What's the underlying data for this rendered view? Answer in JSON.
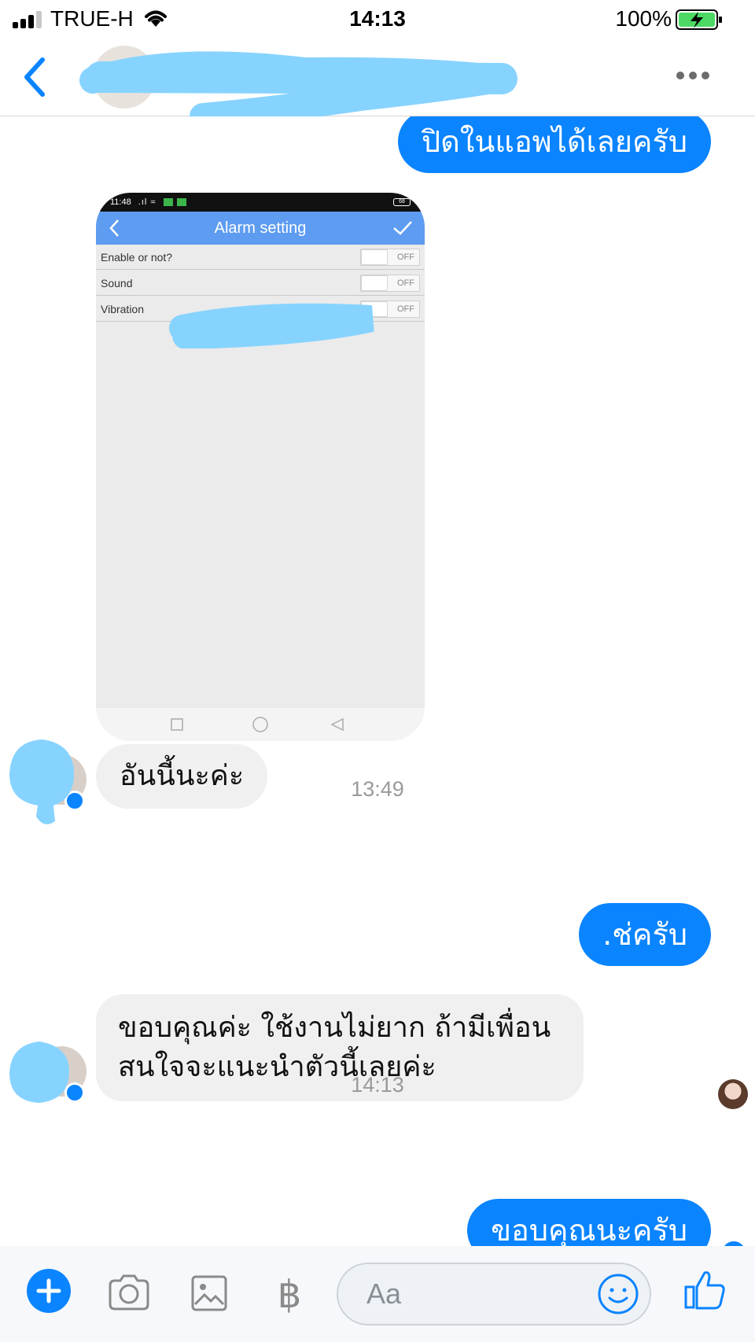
{
  "status_bar": {
    "carrier": "TRUE-H",
    "time": "14:13",
    "battery": "100%"
  },
  "header": {
    "contact_name": "",
    "colors": {
      "accent": "#0a84ff"
    }
  },
  "shared_image": {
    "status_time": "11:48",
    "battery_label": "68",
    "title": "Alarm setting",
    "rows": [
      {
        "label": "Enable or not?",
        "state": "OFF"
      },
      {
        "label": "Sound",
        "state": "OFF"
      },
      {
        "label": "Vibration",
        "state": "OFF"
      }
    ]
  },
  "messages": {
    "out_1": "ปิดในแอพได้เลยครับ",
    "in_1": "อันนี้นะค่ะ",
    "time_1": "13:49",
    "out_2": ".ช่ครับ",
    "in_2_line1": "ขอบคุณค่ะ ใช้งานไม่ยาก ถ้ามีเพื่อน",
    "in_2_line2": "สนใจจะแนะนำตัวนี้เลยค่ะ",
    "time_2": "14:13",
    "out_3": "ขอบคุณนะครับ"
  },
  "composer": {
    "placeholder": "Aa",
    "icons": [
      "plus-icon",
      "camera-icon",
      "image-icon",
      "baht-icon",
      "emoji-icon",
      "thumbs-up-icon"
    ]
  }
}
